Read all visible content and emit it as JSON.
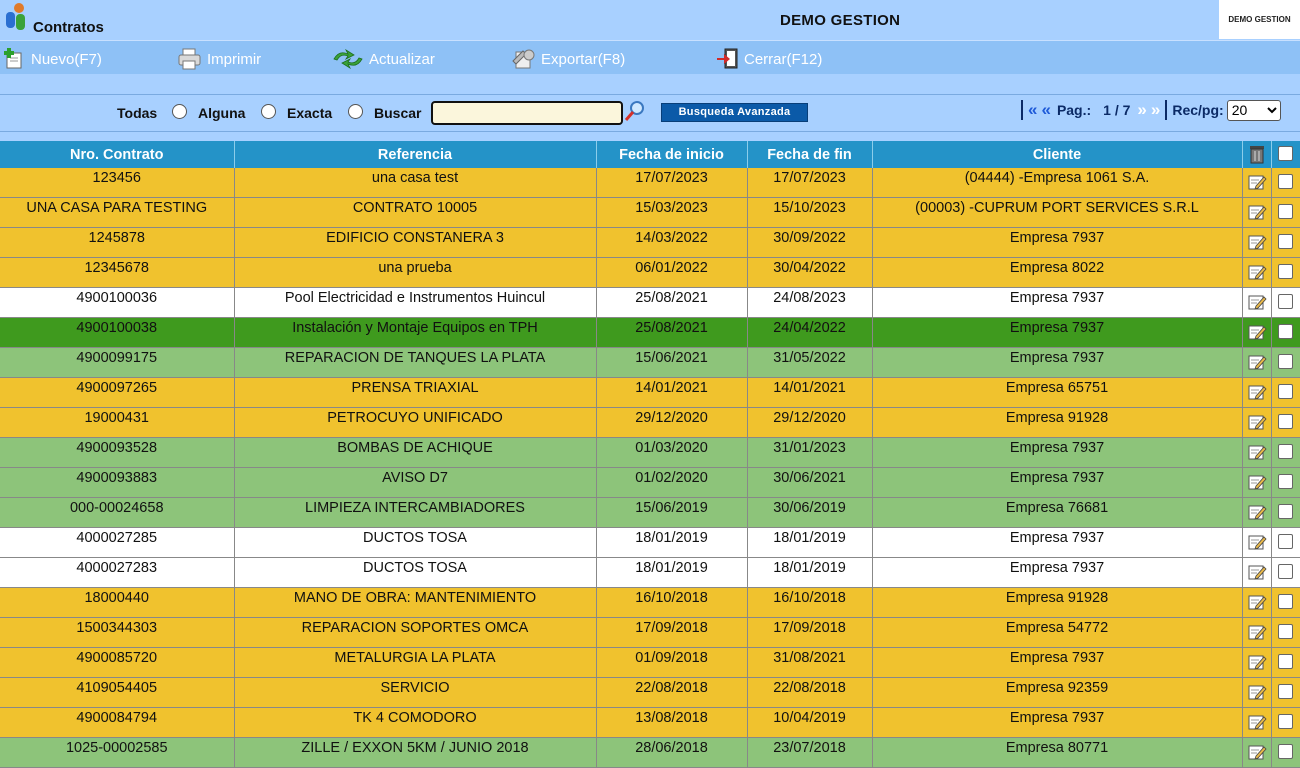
{
  "app": {
    "title": "Contratos",
    "company": "DEMO GESTION",
    "logo_text": "DEMO GESTION"
  },
  "toolbar": {
    "new_label": "Nuevo(F7)",
    "print_label": "Imprimir",
    "refresh_label": "Actualizar",
    "export_label": "Exportar(F8)",
    "close_label": "Cerrar(F12)"
  },
  "search": {
    "option_all": "Todas",
    "option_any": "Alguna",
    "option_exact": "Exacta",
    "search_label": "Buscar",
    "search_value": "",
    "advanced_label": "Busqueda Avanzada"
  },
  "pager": {
    "first": "|«",
    "prev": "«",
    "page_label": "Pag.:",
    "page_value": "1 / 7",
    "next": "»",
    "last": "»|",
    "per_page_label": "Rec/pg:",
    "per_page_value": "20"
  },
  "colors": {
    "yellow": "#f0c22e",
    "white": "#ffffff",
    "green": "#8dc47a",
    "darkgreen": "#3f9a1e",
    "header": "#2493c8"
  },
  "table": {
    "headers": [
      "Nro. Contrato",
      "Referencia",
      "Fecha de inicio",
      "Fecha de fin",
      "Cliente"
    ],
    "rows": [
      {
        "nro": "123456",
        "ref": "una casa test",
        "inicio": "17/07/2023",
        "fin": "17/07/2023",
        "cliente": "(04444) -Empresa 1061 S.A.",
        "color": "yellow"
      },
      {
        "nro": "UNA CASA PARA TESTING",
        "ref": "CONTRATO 10005",
        "inicio": "15/03/2023",
        "fin": "15/10/2023",
        "cliente": "(00003) -CUPRUM PORT SERVICES S.R.L",
        "color": "yellow"
      },
      {
        "nro": "1245878",
        "ref": "EDIFICIO CONSTANERA 3",
        "inicio": "14/03/2022",
        "fin": "30/09/2022",
        "cliente": "Empresa 7937",
        "color": "yellow"
      },
      {
        "nro": "12345678",
        "ref": "una prueba",
        "inicio": "06/01/2022",
        "fin": "30/04/2022",
        "cliente": "Empresa 8022",
        "color": "yellow"
      },
      {
        "nro": "4900100036",
        "ref": "Pool Electricidad e Instrumentos Huincul",
        "inicio": "25/08/2021",
        "fin": "24/08/2023",
        "cliente": "Empresa 7937",
        "color": "white"
      },
      {
        "nro": "4900100038",
        "ref": "Instalación y Montaje Equipos en TPH",
        "inicio": "25/08/2021",
        "fin": "24/04/2022",
        "cliente": "Empresa 7937",
        "color": "darkgreen"
      },
      {
        "nro": "4900099175",
        "ref": "REPARACION DE TANQUES LA PLATA",
        "inicio": "15/06/2021",
        "fin": "31/05/2022",
        "cliente": "Empresa 7937",
        "color": "green"
      },
      {
        "nro": "4900097265",
        "ref": "PRENSA TRIAXIAL",
        "inicio": "14/01/2021",
        "fin": "14/01/2021",
        "cliente": "Empresa 65751",
        "color": "yellow"
      },
      {
        "nro": "19000431",
        "ref": "PETROCUYO UNIFICADO",
        "inicio": "29/12/2020",
        "fin": "29/12/2020",
        "cliente": "Empresa 91928",
        "color": "yellow"
      },
      {
        "nro": "4900093528",
        "ref": "BOMBAS DE ACHIQUE",
        "inicio": "01/03/2020",
        "fin": "31/01/2023",
        "cliente": "Empresa 7937",
        "color": "green"
      },
      {
        "nro": "4900093883",
        "ref": "AVISO D7",
        "inicio": "01/02/2020",
        "fin": "30/06/2021",
        "cliente": "Empresa 7937",
        "color": "green"
      },
      {
        "nro": "000-00024658",
        "ref": "LIMPIEZA INTERCAMBIADORES",
        "inicio": "15/06/2019",
        "fin": "30/06/2019",
        "cliente": "Empresa 76681",
        "color": "green"
      },
      {
        "nro": "4000027285",
        "ref": "DUCTOS TOSA",
        "inicio": "18/01/2019",
        "fin": "18/01/2019",
        "cliente": "Empresa 7937",
        "color": "white"
      },
      {
        "nro": "4000027283",
        "ref": "DUCTOS TOSA",
        "inicio": "18/01/2019",
        "fin": "18/01/2019",
        "cliente": "Empresa 7937",
        "color": "white"
      },
      {
        "nro": "18000440",
        "ref": "MANO DE OBRA: MANTENIMIENTO",
        "inicio": "16/10/2018",
        "fin": "16/10/2018",
        "cliente": "Empresa 91928",
        "color": "yellow"
      },
      {
        "nro": "1500344303",
        "ref": "REPARACION SOPORTES OMCA",
        "inicio": "17/09/2018",
        "fin": "17/09/2018",
        "cliente": "Empresa 54772",
        "color": "yellow"
      },
      {
        "nro": "4900085720",
        "ref": "METALURGIA LA PLATA",
        "inicio": "01/09/2018",
        "fin": "31/08/2021",
        "cliente": "Empresa 7937",
        "color": "yellow"
      },
      {
        "nro": "4109054405",
        "ref": "SERVICIO",
        "inicio": "22/08/2018",
        "fin": "22/08/2018",
        "cliente": "Empresa 92359",
        "color": "yellow"
      },
      {
        "nro": "4900084794",
        "ref": "TK 4 COMODORO",
        "inicio": "13/08/2018",
        "fin": "10/04/2019",
        "cliente": "Empresa 7937",
        "color": "yellow"
      },
      {
        "nro": "1025-00002585",
        "ref": "ZILLE / EXXON 5KM / JUNIO 2018",
        "inicio": "28/06/2018",
        "fin": "23/07/2018",
        "cliente": "Empresa 80771",
        "color": "green"
      }
    ]
  },
  "icons": {
    "app": "app-logo-icon",
    "new": "new-document-icon",
    "print": "printer-icon",
    "refresh": "refresh-icon",
    "export": "export-icon",
    "close": "exit-door-icon",
    "search": "magnifier-icon",
    "delete": "trash-icon",
    "edit": "edit-pencil-icon"
  }
}
